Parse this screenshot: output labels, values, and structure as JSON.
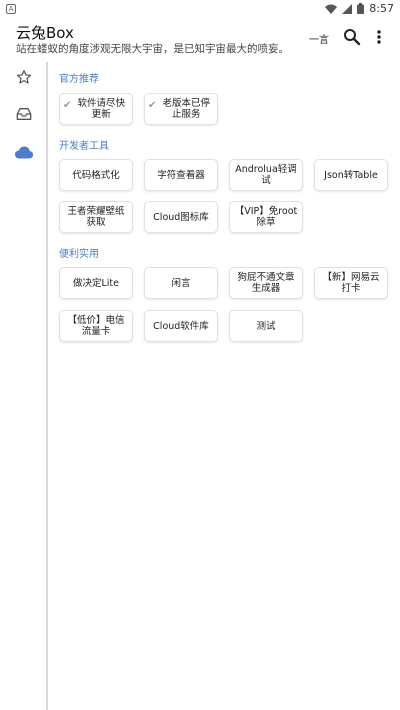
{
  "status_bar": {
    "app_icon_letter": "A",
    "time": "8:57",
    "icons": [
      "wifi-icon",
      "signal-icon",
      "battery-icon"
    ]
  },
  "appbar": {
    "title": "云兔Box",
    "subtitle": "站在蝼蚁的角度涉观无限大宇宙，是已知宇宙最大的喷妄。",
    "yiyan_label": "一言",
    "icons": [
      "search-icon",
      "more-vert-icon"
    ]
  },
  "rail": {
    "items": [
      {
        "icon": "star-icon",
        "selected": false
      },
      {
        "icon": "inbox-icon",
        "selected": false
      },
      {
        "icon": "cloud-icon",
        "selected": true
      }
    ],
    "accent": "#4a7ec9"
  },
  "sections": [
    {
      "title": "官方推荐",
      "items": [
        {
          "label": "软件请尽快更新",
          "checked": true
        },
        {
          "label": "老版本已停止服务",
          "checked": true
        }
      ]
    },
    {
      "title": "开发者工具",
      "items": [
        {
          "label": "代码格式化"
        },
        {
          "label": "字符查看器"
        },
        {
          "label": "Androlua轻调试"
        },
        {
          "label": "Json转Table"
        },
        {
          "label": "王者荣耀壁纸获取"
        },
        {
          "label": "Cloud图标库"
        },
        {
          "label": "【VIP】免root除草"
        }
      ]
    },
    {
      "title": "便利实用",
      "items": [
        {
          "label": "做决定Lite"
        },
        {
          "label": "闲言"
        },
        {
          "label": "狗屁不通文章生成器"
        },
        {
          "label": "【新】网易云打卡"
        },
        {
          "label": "【低价】电信流量卡"
        },
        {
          "label": "Cloud软件库"
        },
        {
          "label": "测试"
        }
      ]
    }
  ]
}
